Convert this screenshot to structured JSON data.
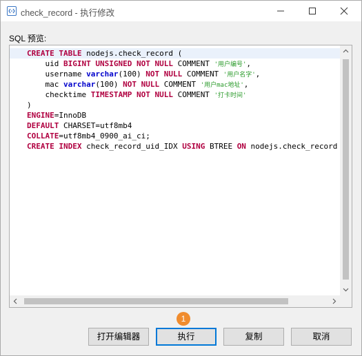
{
  "window": {
    "title": "check_record - 执行修改",
    "icon": "app-sql-icon"
  },
  "sql_label": "SQL 预览:",
  "code_lines": [
    [
      {
        "t": "kw",
        "v": "CREATE"
      },
      {
        "t": "id",
        "v": " "
      },
      {
        "t": "kw",
        "v": "TABLE"
      },
      {
        "t": "id",
        "v": " nodejs.check_record ("
      }
    ],
    [
      {
        "t": "id",
        "v": "    uid "
      },
      {
        "t": "kw",
        "v": "BIGINT"
      },
      {
        "t": "id",
        "v": " "
      },
      {
        "t": "kw",
        "v": "UNSIGNED"
      },
      {
        "t": "id",
        "v": " "
      },
      {
        "t": "kw",
        "v": "NOT"
      },
      {
        "t": "id",
        "v": " "
      },
      {
        "t": "kw",
        "v": "NULL"
      },
      {
        "t": "id",
        "v": " COMMENT "
      },
      {
        "t": "str",
        "v": "'用户编号'"
      },
      {
        "t": "id",
        "v": ","
      }
    ],
    [
      {
        "t": "id",
        "v": "    username "
      },
      {
        "t": "typ",
        "v": "varchar"
      },
      {
        "t": "id",
        "v": "(100) "
      },
      {
        "t": "kw",
        "v": "NOT"
      },
      {
        "t": "id",
        "v": " "
      },
      {
        "t": "kw",
        "v": "NULL"
      },
      {
        "t": "id",
        "v": " COMMENT "
      },
      {
        "t": "str",
        "v": "'用户名字'"
      },
      {
        "t": "id",
        "v": ","
      }
    ],
    [
      {
        "t": "id",
        "v": "    mac "
      },
      {
        "t": "typ",
        "v": "varchar"
      },
      {
        "t": "id",
        "v": "(100) "
      },
      {
        "t": "kw",
        "v": "NOT"
      },
      {
        "t": "id",
        "v": " "
      },
      {
        "t": "kw",
        "v": "NULL"
      },
      {
        "t": "id",
        "v": " COMMENT "
      },
      {
        "t": "str",
        "v": "'用户mac地址'"
      },
      {
        "t": "id",
        "v": ","
      }
    ],
    [
      {
        "t": "id",
        "v": "    checktime "
      },
      {
        "t": "kw",
        "v": "TIMESTAMP"
      },
      {
        "t": "id",
        "v": " "
      },
      {
        "t": "kw",
        "v": "NOT"
      },
      {
        "t": "id",
        "v": " "
      },
      {
        "t": "kw",
        "v": "NULL"
      },
      {
        "t": "id",
        "v": " COMMENT "
      },
      {
        "t": "str",
        "v": "'打卡时间'"
      }
    ],
    [
      {
        "t": "id",
        "v": ")"
      }
    ],
    [
      {
        "t": "kw",
        "v": "ENGINE"
      },
      {
        "t": "id",
        "v": "=InnoDB"
      }
    ],
    [
      {
        "t": "kw",
        "v": "DEFAULT"
      },
      {
        "t": "id",
        "v": " CHARSET=utf8mb4"
      }
    ],
    [
      {
        "t": "kw",
        "v": "COLLATE"
      },
      {
        "t": "id",
        "v": "=utf8mb4_0900_ai_ci;"
      }
    ],
    [
      {
        "t": "kw",
        "v": "CREATE"
      },
      {
        "t": "id",
        "v": " "
      },
      {
        "t": "kw",
        "v": "INDEX"
      },
      {
        "t": "id",
        "v": " check_record_uid_IDX "
      },
      {
        "t": "kw",
        "v": "USING"
      },
      {
        "t": "id",
        "v": " BTREE "
      },
      {
        "t": "kw",
        "v": "ON"
      },
      {
        "t": "id",
        "v": " nodejs.check_record (uid);"
      }
    ]
  ],
  "badge": "1",
  "buttons": {
    "open_editor": "打开编辑器",
    "execute": "执行",
    "copy": "复制",
    "cancel": "取消"
  },
  "colors": {
    "keyword": "#b00040",
    "type": "#0000cc",
    "string": "#2a9a2a",
    "accent": "#0078d7",
    "badge": "#f08c2e"
  }
}
